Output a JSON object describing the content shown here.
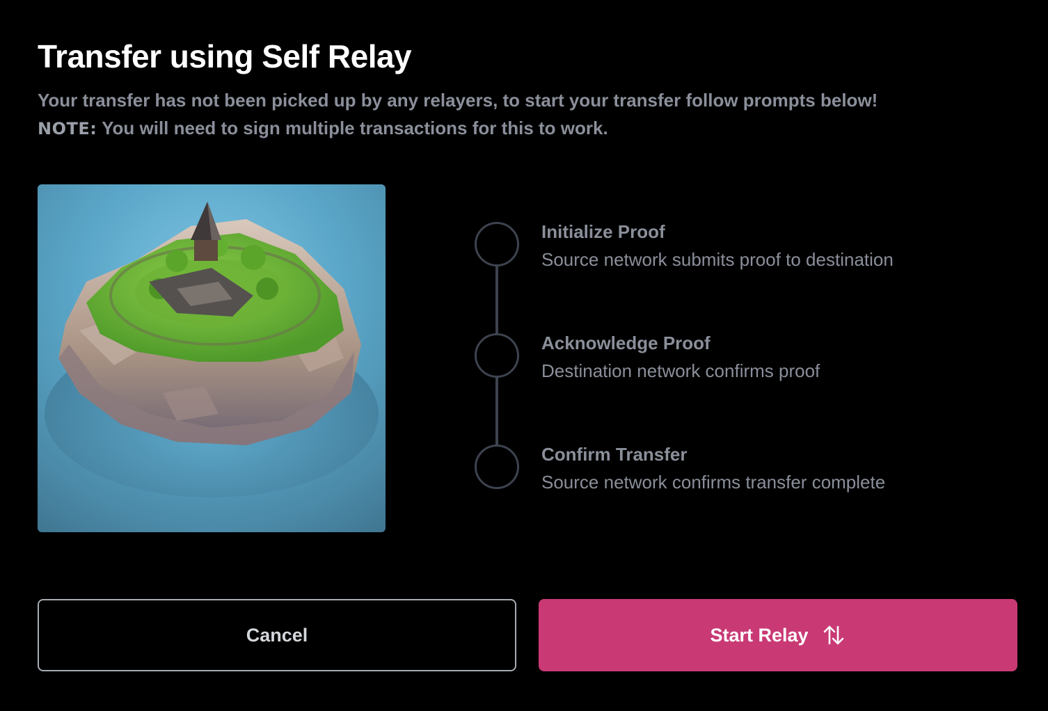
{
  "header": {
    "title": "Transfer using Self Relay",
    "subtitle": "Your transfer has not been picked up by any relayers, to start your transfer follow prompts below!",
    "note_label": "NOTE:",
    "note_text": " You will need to sign multiple transactions for this to work."
  },
  "steps": [
    {
      "title": "Initialize Proof",
      "description": "Source network submits proof to destination"
    },
    {
      "title": "Acknowledge Proof",
      "description": "Destination network confirms proof"
    },
    {
      "title": "Confirm Transfer",
      "description": "Source network confirms transfer complete"
    }
  ],
  "actions": {
    "cancel_label": "Cancel",
    "start_label": "Start Relay",
    "start_icon": "arrows-up-down-icon"
  },
  "colors": {
    "background": "#000000",
    "accent": "#c93a75",
    "muted_text": "#8a8f9a",
    "step_ring": "#3d434f"
  }
}
